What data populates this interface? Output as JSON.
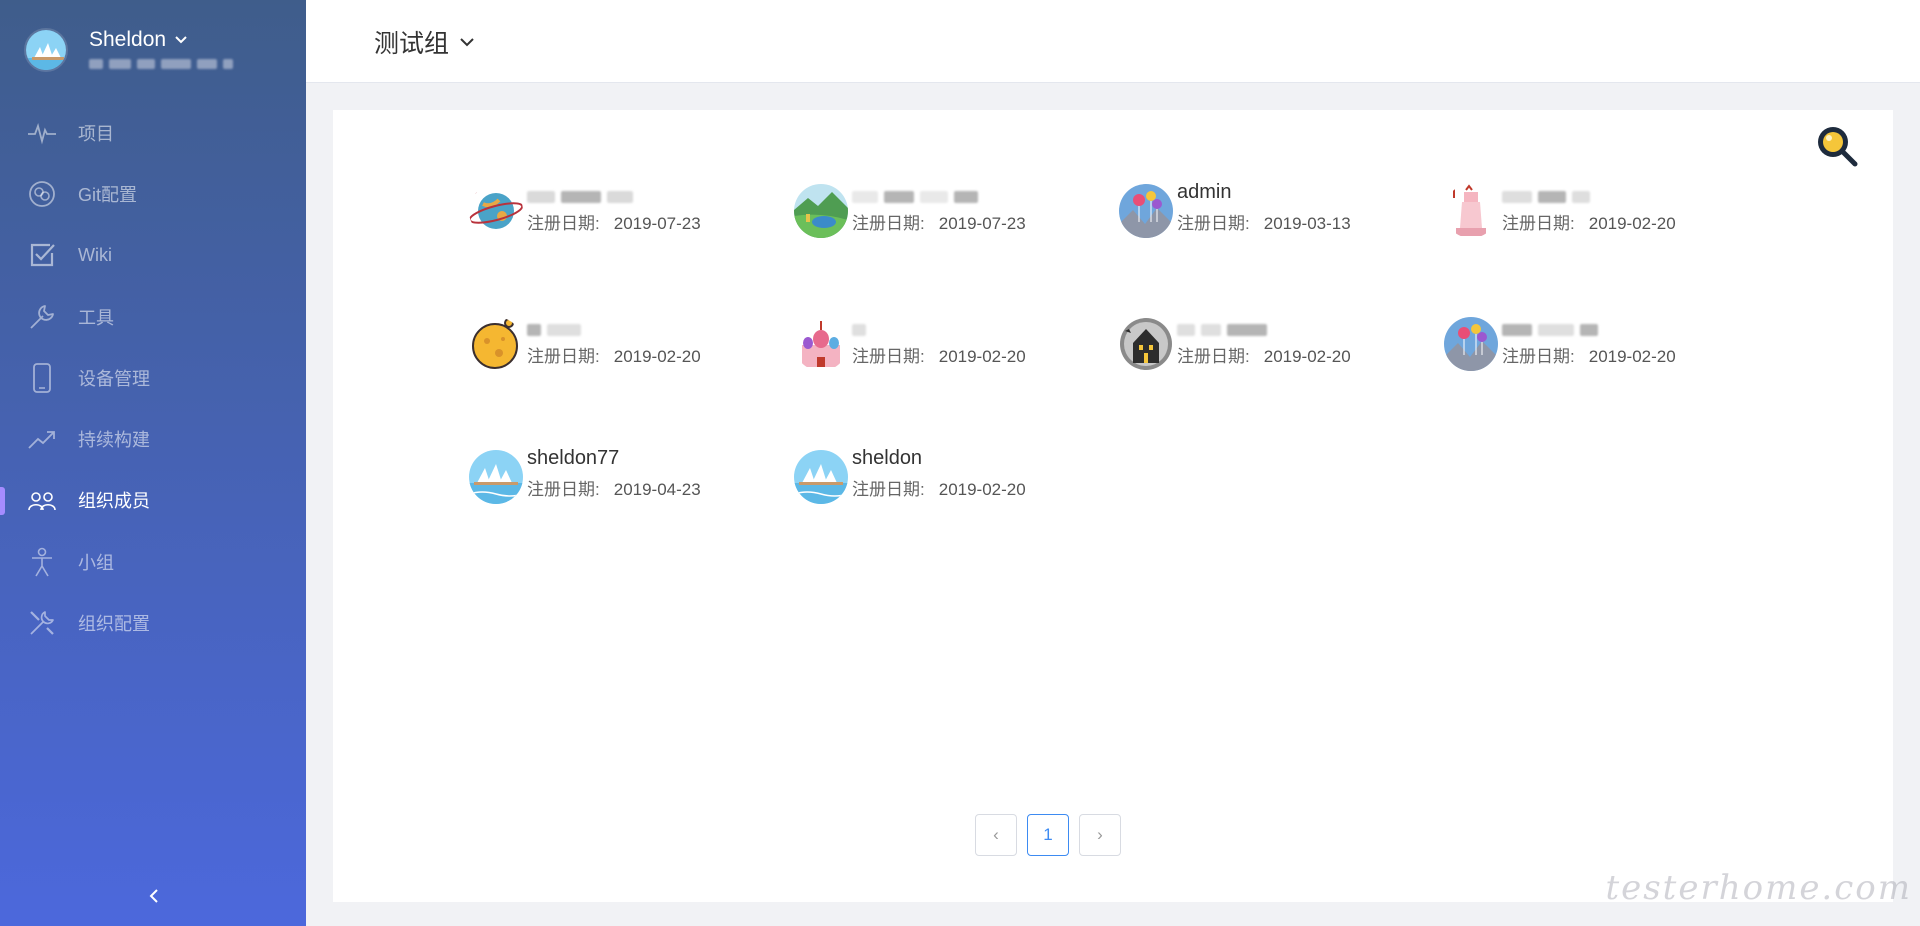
{
  "user": {
    "name": "Sheldon"
  },
  "nav": {
    "items": [
      {
        "label": "项目",
        "icon": "pulse-icon"
      },
      {
        "label": "Git配置",
        "icon": "git-icon"
      },
      {
        "label": "Wiki",
        "icon": "checkbox-icon"
      },
      {
        "label": "工具",
        "icon": "wrench-icon"
      },
      {
        "label": "设备管理",
        "icon": "phone-icon"
      },
      {
        "label": "持续构建",
        "icon": "trend-icon"
      },
      {
        "label": "组织成员",
        "icon": "members-icon",
        "active": true
      },
      {
        "label": "小组",
        "icon": "person-icon"
      },
      {
        "label": "组织配置",
        "icon": "tools-icon"
      }
    ]
  },
  "header": {
    "group_title": "测试组"
  },
  "members": {
    "date_label": "注册日期:",
    "items": [
      {
        "name": "",
        "date": "2019-07-23",
        "avatar": "planet"
      },
      {
        "name": "",
        "date": "2019-07-23",
        "avatar": "landscape"
      },
      {
        "name": "admin",
        "date": "2019-03-13",
        "avatar": "balloons"
      },
      {
        "name": "",
        "date": "2019-02-20",
        "avatar": "liberty"
      },
      {
        "name": "",
        "date": "2019-02-20",
        "avatar": "moon"
      },
      {
        "name": "",
        "date": "2019-02-20",
        "avatar": "castle"
      },
      {
        "name": "",
        "date": "2019-02-20",
        "avatar": "haunted"
      },
      {
        "name": "",
        "date": "2019-02-20",
        "avatar": "balloons"
      },
      {
        "name": "sheldon77",
        "date": "2019-04-23",
        "avatar": "opera"
      },
      {
        "name": "sheldon",
        "date": "2019-02-20",
        "avatar": "opera"
      }
    ]
  },
  "pagination": {
    "prev": "‹",
    "current": "1",
    "next": "›"
  },
  "watermark": "testerhome.com",
  "colors": {
    "accent": "#3d8bf2",
    "sidebar_top": "#3f5d8b",
    "sidebar_bottom": "#4c68dc",
    "active_marker": "#a58cff"
  }
}
